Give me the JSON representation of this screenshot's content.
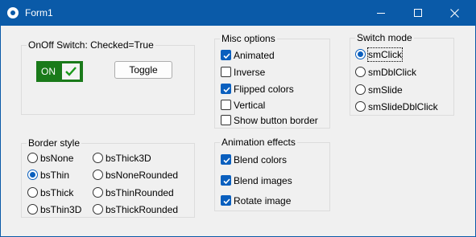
{
  "window": {
    "title": "Form1"
  },
  "switch_group": {
    "title": "OnOff Switch: Checked=True",
    "switch_label": "ON",
    "toggle_label": "Toggle"
  },
  "misc": {
    "title": "Misc options",
    "items": [
      {
        "label": "Animated",
        "checked": true
      },
      {
        "label": "Inverse",
        "checked": false
      },
      {
        "label": "Flipped colors",
        "checked": true
      },
      {
        "label": "Vertical",
        "checked": false
      },
      {
        "label": "Show button border",
        "checked": false
      }
    ]
  },
  "mode": {
    "title": "Switch mode",
    "items": [
      {
        "label": "smClick",
        "selected": true
      },
      {
        "label": "smDblClick",
        "selected": false
      },
      {
        "label": "smSlide",
        "selected": false
      },
      {
        "label": "smSlideDblClick",
        "selected": false
      }
    ]
  },
  "border": {
    "title": "Border style",
    "items": [
      {
        "label": "bsNone",
        "selected": false
      },
      {
        "label": "bsThin",
        "selected": true
      },
      {
        "label": "bsThick",
        "selected": false
      },
      {
        "label": "bsThin3D",
        "selected": false
      },
      {
        "label": "bsThick3D",
        "selected": false
      },
      {
        "label": "bsNoneRounded",
        "selected": false
      },
      {
        "label": "bsThinRounded",
        "selected": false
      },
      {
        "label": "bsThickRounded",
        "selected": false
      }
    ]
  },
  "anim": {
    "title": "Animation effects",
    "items": [
      {
        "label": "Blend colors",
        "checked": true
      },
      {
        "label": "Blend images",
        "checked": true
      },
      {
        "label": "Rotate image",
        "checked": true
      }
    ]
  },
  "colors": {
    "titlebar": "#0a5aa8",
    "accent": "#0a5fbe",
    "switch_on": "#1a7a1a"
  }
}
